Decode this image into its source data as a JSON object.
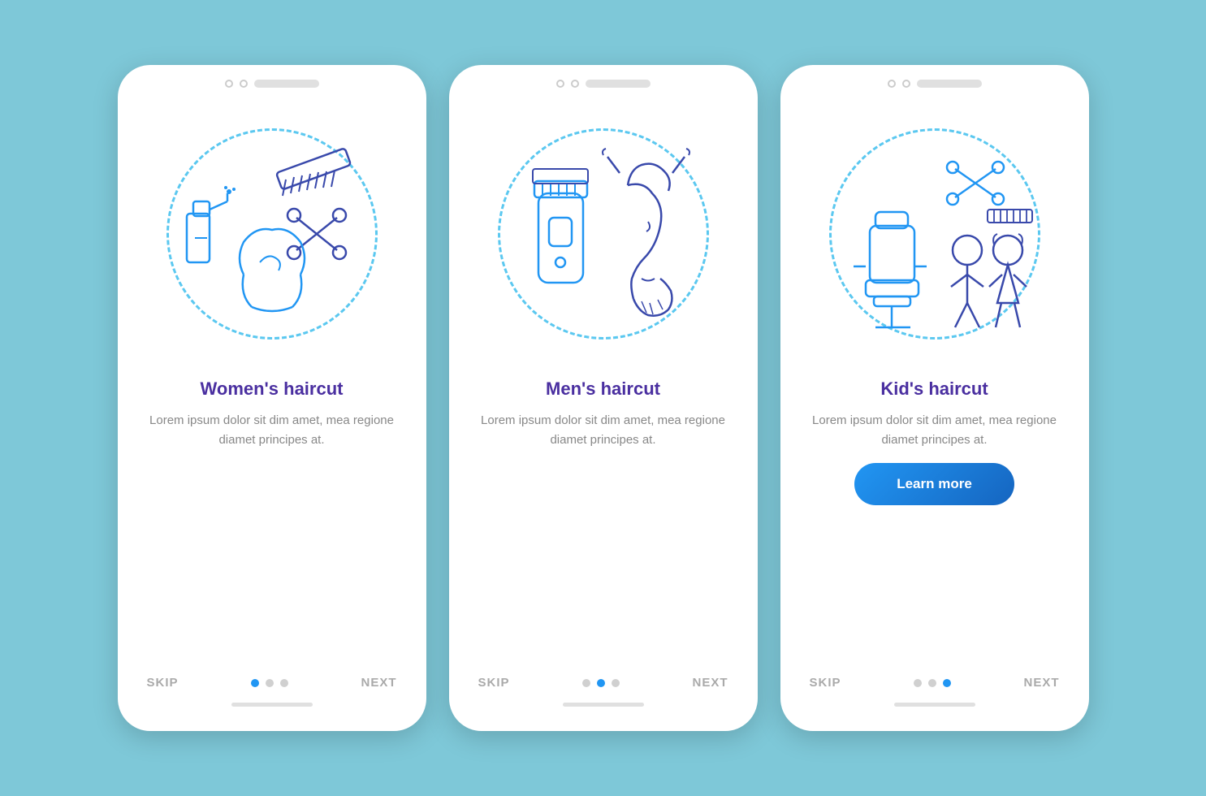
{
  "screens": [
    {
      "id": "womens",
      "title": "Women's haircut",
      "description": "Lorem ipsum dolor sit dim amet, mea regione diamet principes at.",
      "skip_label": "SKIP",
      "next_label": "NEXT",
      "dots": [
        true,
        false,
        false
      ],
      "show_button": false,
      "button_label": ""
    },
    {
      "id": "mens",
      "title": "Men's haircut",
      "description": "Lorem ipsum dolor sit dim amet, mea regione diamet principes at.",
      "skip_label": "SKIP",
      "next_label": "NEXT",
      "dots": [
        false,
        true,
        false
      ],
      "show_button": false,
      "button_label": ""
    },
    {
      "id": "kids",
      "title": "Kid's haircut",
      "description": "Lorem ipsum dolor sit dim amet, mea regione diamet principes at.",
      "skip_label": "SKIP",
      "next_label": "NEXT",
      "dots": [
        false,
        false,
        true
      ],
      "show_button": true,
      "button_label": "Learn more"
    }
  ],
  "colors": {
    "background": "#7ec8d8",
    "card": "#ffffff",
    "title": "#4a2fa0",
    "desc": "#888888",
    "button_bg": "#1976d2",
    "dot_active": "#2196F3",
    "dot_inactive": "#d0d0d0",
    "dashed_circle": "#5bc8f0",
    "icon_blue": "#2196F3",
    "icon_purple": "#4a2fa0"
  }
}
